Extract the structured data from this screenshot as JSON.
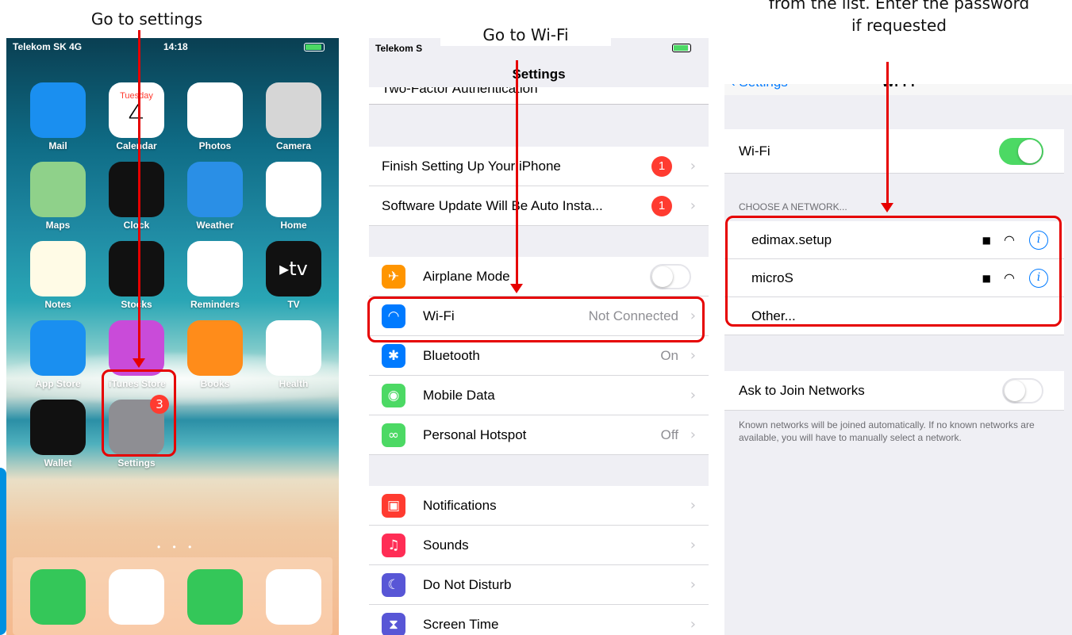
{
  "captions": {
    "step1": "Go to settings",
    "step2": "Go to Wi-Fi",
    "step3_line1": "from the list. Enter the password",
    "step3_line2": "if requested"
  },
  "home": {
    "status": {
      "carrier": "Telekom SK 4G",
      "time": "14:18"
    },
    "apps": [
      {
        "label": "Mail",
        "icon": "mail-icon",
        "color": "#1a8ff0"
      },
      {
        "label": "Calendar",
        "icon": "calendar-icon",
        "color": "#ffffff",
        "day": "Tuesday",
        "date": "4"
      },
      {
        "label": "Photos",
        "icon": "photos-icon",
        "color": "#ffffff"
      },
      {
        "label": "Camera",
        "icon": "camera-icon",
        "color": "#d6d6d6"
      },
      {
        "label": "Maps",
        "icon": "maps-icon",
        "color": "#8fd18a"
      },
      {
        "label": "Clock",
        "icon": "clock-icon",
        "color": "#111111"
      },
      {
        "label": "Weather",
        "icon": "weather-icon",
        "color": "#2a8fe6"
      },
      {
        "label": "Home",
        "icon": "home-icon",
        "color": "#ffffff"
      },
      {
        "label": "Notes",
        "icon": "notes-icon",
        "color": "#fffbe6"
      },
      {
        "label": "Stocks",
        "icon": "stocks-icon",
        "color": "#111111"
      },
      {
        "label": "Reminders",
        "icon": "reminders-icon",
        "color": "#ffffff"
      },
      {
        "label": "TV",
        "icon": "tv-icon",
        "color": "#111111",
        "glyph": "▸tv"
      },
      {
        "label": "App Store",
        "icon": "app-store-icon",
        "color": "#1a8ff0"
      },
      {
        "label": "iTunes Store",
        "icon": "itunes-store-icon",
        "color": "#c94bd9"
      },
      {
        "label": "Books",
        "icon": "books-icon",
        "color": "#ff8c1a"
      },
      {
        "label": "Health",
        "icon": "health-icon",
        "color": "#ffffff"
      },
      {
        "label": "Wallet",
        "icon": "wallet-icon",
        "color": "#111111"
      },
      {
        "label": "Settings",
        "icon": "settings-icon",
        "color": "#8e8e93",
        "badge": "3"
      }
    ],
    "dock": [
      {
        "icon": "phone-icon",
        "color": "#34c759"
      },
      {
        "icon": "safari-icon",
        "color": "#ffffff"
      },
      {
        "icon": "messages-icon",
        "color": "#34c759"
      },
      {
        "icon": "music-icon",
        "color": "#ffffff"
      }
    ]
  },
  "settings": {
    "status": {
      "carrier": "Telekom S"
    },
    "title": "Settings",
    "cut_row": "Two-Factor Authentication",
    "group1": [
      {
        "label": "Finish Setting Up Your iPhone",
        "badge": "1"
      },
      {
        "label": "Software Update Will Be Auto Insta...",
        "badge": "1"
      }
    ],
    "group2": [
      {
        "label": "Airplane Mode",
        "icon": "airplane-icon",
        "color": "#ff9500",
        "glyph": "✈",
        "toggle": "off"
      },
      {
        "label": "Wi-Fi",
        "icon": "wifi-icon",
        "color": "#007aff",
        "glyph": "◠",
        "value": "Not Connected"
      },
      {
        "label": "Bluetooth",
        "icon": "bluetooth-icon",
        "color": "#007aff",
        "glyph": "✱",
        "value": "On"
      },
      {
        "label": "Mobile Data",
        "icon": "mobile-data-icon",
        "color": "#4cd964",
        "glyph": "◉",
        "value": ""
      },
      {
        "label": "Personal Hotspot",
        "icon": "hotspot-icon",
        "color": "#4cd964",
        "glyph": "∞",
        "value": "Off"
      }
    ],
    "group3": [
      {
        "label": "Notifications",
        "icon": "notifications-icon",
        "color": "#ff3b30",
        "glyph": "▣"
      },
      {
        "label": "Sounds",
        "icon": "sounds-icon",
        "color": "#ff2d55",
        "glyph": "♫"
      },
      {
        "label": "Do Not Disturb",
        "icon": "moon-icon",
        "color": "#5856d6",
        "glyph": "☾"
      },
      {
        "label": "Screen Time",
        "icon": "hourglass-icon",
        "color": "#5856d6",
        "glyph": "⧗"
      }
    ]
  },
  "wifi": {
    "back": "‹ Settings",
    "title": "Wi-Fi",
    "toggle_label": "Wi-Fi",
    "section": "CHOOSE A NETWORK...",
    "networks": [
      {
        "name": "edimax.setup",
        "locked": true
      },
      {
        "name": "microS",
        "locked": true
      }
    ],
    "other": "Other...",
    "ask_label": "Ask to Join Networks",
    "footer": "Known networks will be joined automatically. If no known networks are available, you will have to manually select a network."
  },
  "colors": {
    "highlight": "#e60000",
    "ios_blue": "#007aff",
    "toggle_green": "#4cd964"
  }
}
